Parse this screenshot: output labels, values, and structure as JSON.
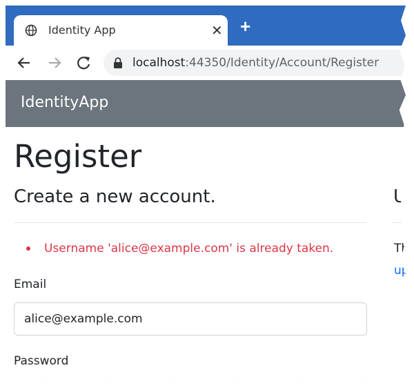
{
  "browser": {
    "tab": {
      "title": "Identity App",
      "icon": "globe-icon",
      "close_glyph": "✕"
    },
    "new_tab_glyph": "+",
    "nav": {
      "back_icon": "arrow-left-icon",
      "forward_icon": "arrow-right-icon",
      "reload_icon": "reload-icon"
    },
    "address": {
      "lock_icon": "lock-icon",
      "host": "localhost",
      "rest": ":44350/Identity/Account/Register"
    },
    "colors": {
      "tabstrip": "#2f6bbf",
      "omnibox": "#f1f3f4"
    }
  },
  "app": {
    "brand": "IdentityApp",
    "navbar_color": "#6c757d"
  },
  "page": {
    "title": "Register",
    "subtitle": "Create a new account.",
    "side_title": "U",
    "side_text_1": "Th",
    "side_text_2": "up",
    "errors": [
      "Username 'alice@example.com' is already taken."
    ],
    "error_color": "#dc3545",
    "email_label": "Email",
    "email_value": "alice@example.com",
    "password_label": "Password"
  }
}
